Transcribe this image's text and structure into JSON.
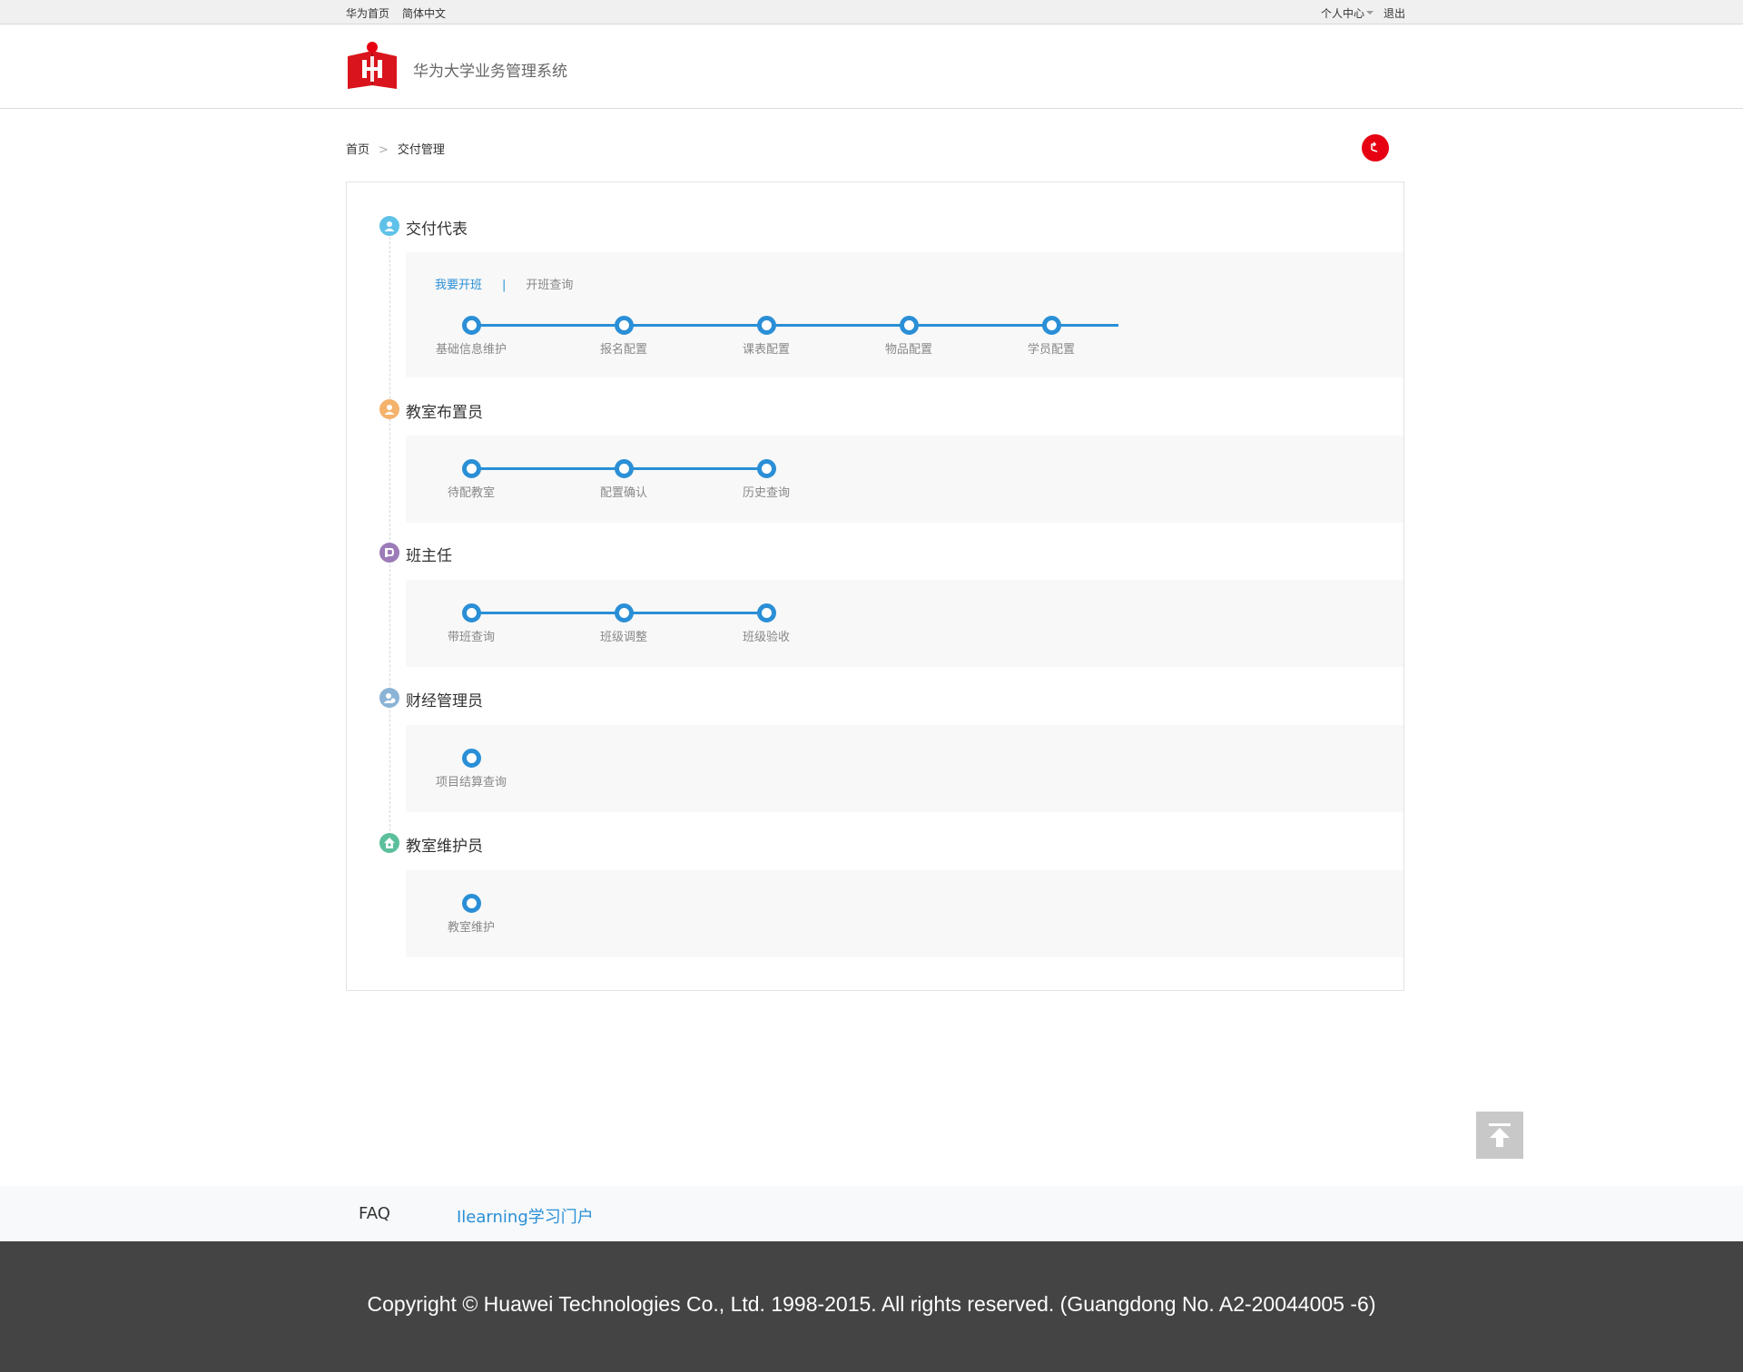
{
  "topbar": {
    "home_link": "华为首页",
    "lang_link": "简体中文",
    "personal_center": "个人中心",
    "logout": "退出"
  },
  "header": {
    "system_title": "华为大学业务管理系统"
  },
  "breadcrumb": {
    "home": "首页",
    "separator": ">",
    "current": "交付管理"
  },
  "roles": [
    {
      "title": "交付代表",
      "icon": "user-icon",
      "icon_color": "#5ec1e8",
      "tabs": [
        {
          "label": "我要开班",
          "active": true
        },
        {
          "label": "开班查询",
          "active": false
        }
      ],
      "tab_separator": "|",
      "steps": [
        "基础信息维护",
        "报名配置",
        "课表配置",
        "物品配置",
        "学员配置"
      ]
    },
    {
      "title": "教室布置员",
      "icon": "user-icon",
      "icon_color": "#f5b26b",
      "steps": [
        "待配教室",
        "配置确认",
        "历史查询"
      ]
    },
    {
      "title": "班主任",
      "icon": "teacher-icon",
      "icon_color": "#9c7bb8",
      "steps": [
        "带班查询",
        "班级调整",
        "班级验收"
      ]
    },
    {
      "title": "财经管理员",
      "icon": "finance-user-icon",
      "icon_color": "#8bb3d6",
      "steps": [
        "项目结算查询"
      ]
    },
    {
      "title": "教室维护员",
      "icon": "maintenance-icon",
      "icon_color": "#5cbf9b",
      "steps": [
        "教室维护"
      ]
    }
  ],
  "footer": {
    "faq": "FAQ",
    "ilearning": "Ilearning学习门户",
    "copyright": "Copyright © Huawei Technologies Co., Ltd. 1998-2015. All rights reserved. (Guangdong No. A2-20044005 -6)"
  },
  "colors": {
    "accent": "#2a8fd6",
    "brand_red": "#e60012",
    "footer_bg": "#444444"
  }
}
